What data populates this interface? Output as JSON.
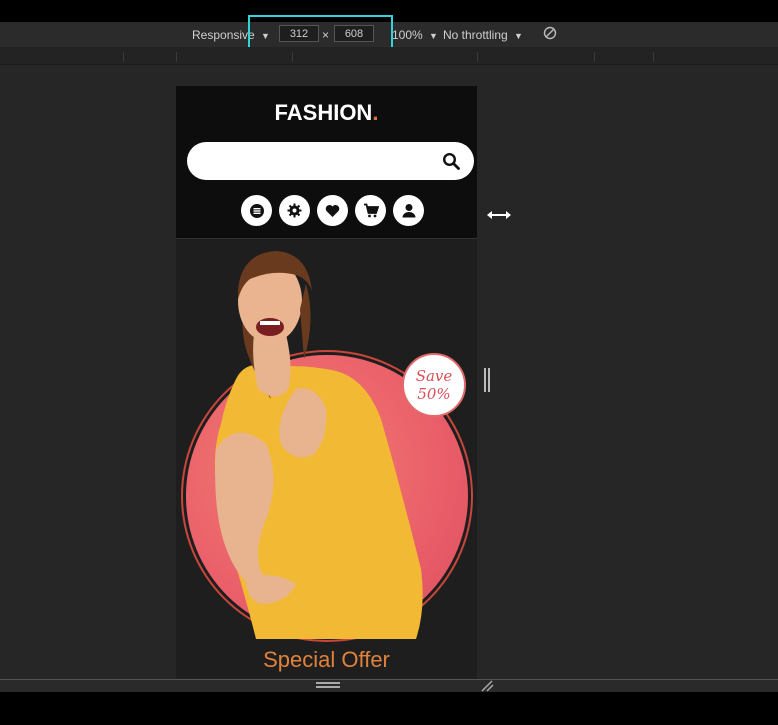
{
  "devtools": {
    "device_mode": "Responsive",
    "width_value": "312",
    "height_value": "608",
    "times_glyph": "×",
    "zoom_label": "100%",
    "throttling_label": "No throttling",
    "dropdown_arrow": "▼"
  },
  "site": {
    "brand_main": "FASHION",
    "brand_dot": ".",
    "search_placeholder": "",
    "nav_icons": [
      "menu-icon",
      "settings-icon",
      "heart-icon",
      "cart-icon",
      "user-icon"
    ],
    "badge_line1": "Save",
    "badge_line2": "50%",
    "special_offer": "Special Offer"
  },
  "colors": {
    "highlight": "#2fd5d9",
    "brand_accent": "#e0713c",
    "offer_text": "#e0823c",
    "circle": "#ea5e6a"
  }
}
